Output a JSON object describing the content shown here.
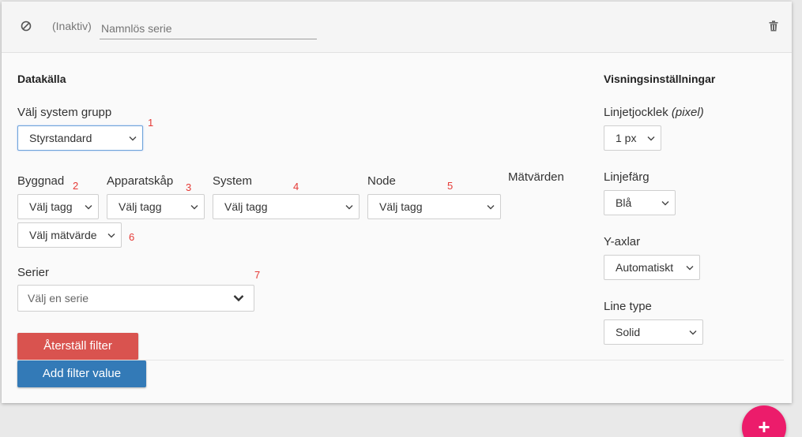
{
  "header": {
    "status": "(Inaktiv)",
    "name_placeholder": "Namnlös serie"
  },
  "datasource": {
    "title": "Datakälla",
    "system_group": {
      "label": "Välj system grupp",
      "value": "Styrstandard",
      "marker": "1"
    },
    "building": {
      "label": "Byggnad",
      "value": "Välj tagg",
      "marker": "2"
    },
    "cabinet": {
      "label": "Apparatskåp",
      "value": "Välj tagg",
      "marker": "3"
    },
    "system": {
      "label": "System",
      "value": "Välj tagg",
      "marker": "4"
    },
    "node": {
      "label": "Node",
      "value": "Välj tagg",
      "marker": "5"
    },
    "measurements": {
      "label": "Mätvärden",
      "value": "Välj mätvärde",
      "marker": "6"
    },
    "series": {
      "label": "Serier",
      "placeholder": "Välj en serie",
      "marker": "7"
    },
    "reset_button": "Återställ filter",
    "add_button": "Add filter value"
  },
  "display": {
    "title": "Visningsinställningar",
    "line_width": {
      "label_main": "Linjetjocklek ",
      "label_unit": "(pixel)",
      "value": "1 px"
    },
    "line_color": {
      "label": "Linjefärg",
      "value": "Blå"
    },
    "y_axes": {
      "label": "Y-axlar",
      "value": "Automatiskt"
    },
    "line_type": {
      "label": "Line type",
      "value": "Solid"
    }
  },
  "fab": {
    "symbol": "+"
  },
  "colors": {
    "danger": "#d9534f",
    "primary": "#337ab7",
    "fab": "#ec1c6b",
    "marker": "#e53935"
  }
}
